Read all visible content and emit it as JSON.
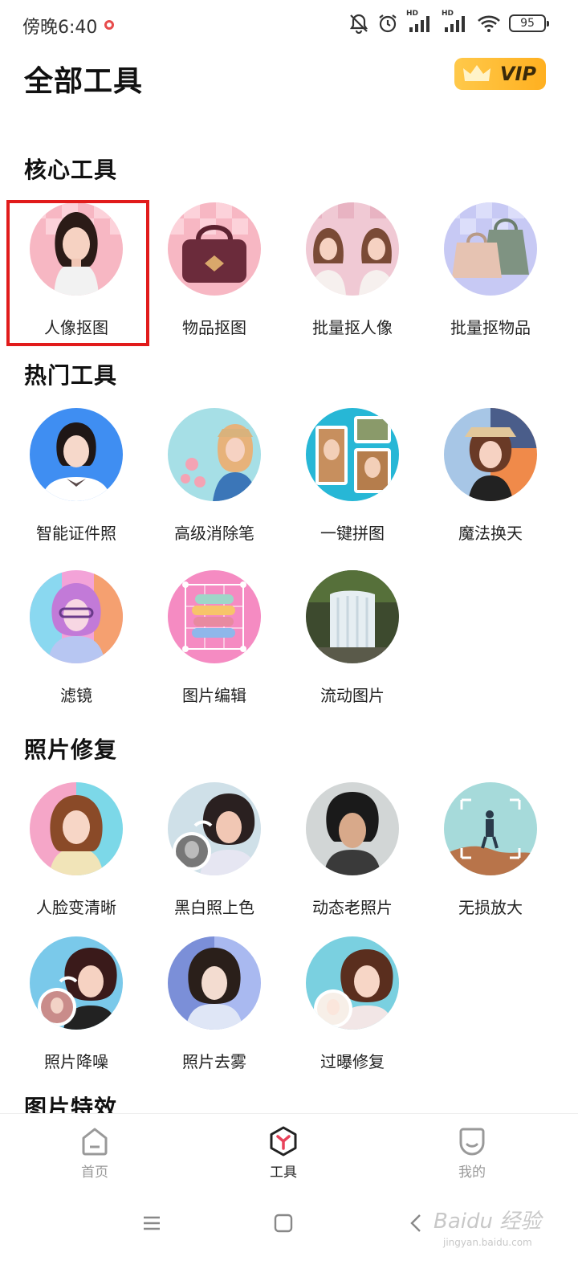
{
  "status_bar": {
    "time": "傍晚6:40",
    "signal_badge_1": "HD",
    "signal_badge_2": "HD",
    "battery": "95",
    "icons": [
      "mute-bell-icon",
      "alarm-icon",
      "signal-icon",
      "signal-icon",
      "wifi-icon",
      "battery-icon"
    ]
  },
  "header": {
    "title": "全部工具",
    "vip_label": "VIP"
  },
  "sections": [
    {
      "title": "核心工具",
      "tools": [
        {
          "label": "人像抠图",
          "highlighted": true
        },
        {
          "label": "物品抠图"
        },
        {
          "label": "批量抠人像"
        },
        {
          "label": "批量抠物品"
        }
      ]
    },
    {
      "title": "热门工具",
      "tools": [
        {
          "label": "智能证件照"
        },
        {
          "label": "高级消除笔"
        },
        {
          "label": "一键拼图"
        },
        {
          "label": "魔法换天"
        },
        {
          "label": "滤镜"
        },
        {
          "label": "图片编辑"
        },
        {
          "label": "流动图片"
        }
      ]
    },
    {
      "title": "照片修复",
      "tools": [
        {
          "label": "人脸变清晰"
        },
        {
          "label": "黑白照上色"
        },
        {
          "label": "动态老照片"
        },
        {
          "label": "无损放大"
        },
        {
          "label": "照片降噪"
        },
        {
          "label": "照片去雾"
        },
        {
          "label": "过曝修复"
        }
      ]
    },
    {
      "title": "图片特效",
      "tools": []
    }
  ],
  "bottom_nav": {
    "items": [
      {
        "label": "首页",
        "icon": "home-icon",
        "active": false
      },
      {
        "label": "工具",
        "icon": "tools-icon",
        "active": true
      },
      {
        "label": "我的",
        "icon": "profile-icon",
        "active": false
      }
    ]
  },
  "watermark": {
    "text": "Baidu 经验",
    "sub": "jingyan.baidu.com"
  },
  "colors": {
    "highlight": "#e11b1b",
    "vip_bg": "#ffb020",
    "active_nav": "#222222"
  }
}
